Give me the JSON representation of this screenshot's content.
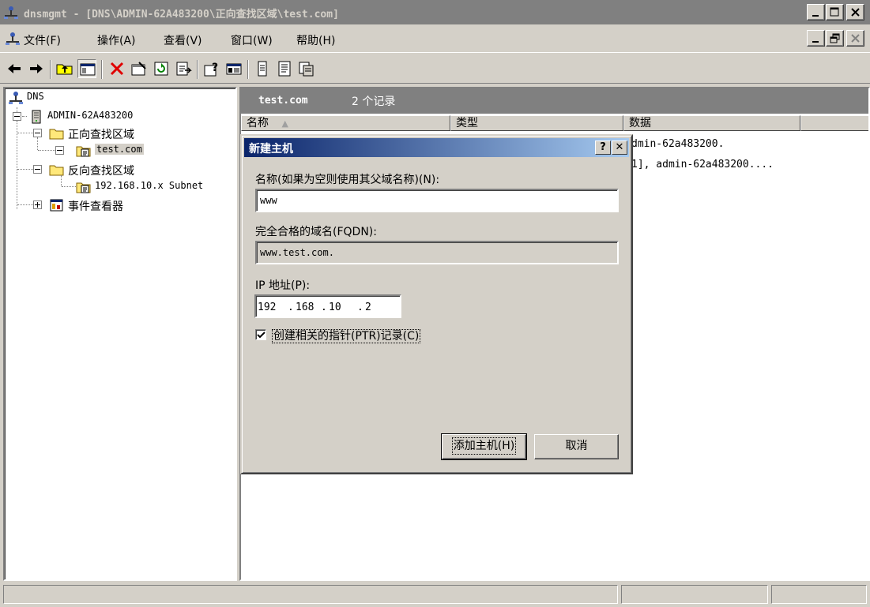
{
  "window": {
    "title": "dnsmgmt - [DNS\\ADMIN-62A483200\\正向查找区域\\test.com]"
  },
  "menubar": {
    "items": [
      "文件(F)",
      "操作(A)",
      "查看(V)",
      "窗口(W)",
      "帮助(H)"
    ]
  },
  "toolbar": {
    "buttons": [
      "back-icon",
      "forward-icon",
      "up-level-icon",
      "show-hide-tree-icon",
      "delete-icon",
      "properties-icon",
      "refresh-icon",
      "export-list-icon",
      "help-icon",
      "console-icon",
      "new-record-icon",
      "new-host-icon",
      "new-domain-icon"
    ]
  },
  "tree": {
    "root": "DNS",
    "server": "ADMIN-62A483200",
    "forward_zones": "正向查找区域",
    "forward_zone_item": "test.com",
    "reverse_zones": "反向查找区域",
    "reverse_zone_item": "192.168.10.x Subnet",
    "event_viewer": "事件查看器"
  },
  "list": {
    "zone_name": "test.com",
    "record_count": "2 个记录",
    "columns": [
      "名称",
      "类型",
      "数据"
    ],
    "rows": [
      {
        "data": "dmin-62a483200."
      },
      {
        "data": "1], admin-62a483200...."
      }
    ]
  },
  "dialog": {
    "title": "新建主机",
    "help_button": "?",
    "close_button": "✕",
    "name_label": "名称(如果为空则使用其父域名称)(N):",
    "name_value": "www",
    "fqdn_label": "完全合格的域名(FQDN):",
    "fqdn_value": "www.test.com.",
    "ip_label": "IP 地址(P):",
    "ip_octets": [
      "192",
      "168",
      "10",
      "2"
    ],
    "ptr_checkbox_label": "创建相关的指针(PTR)记录(C)",
    "ptr_checked": true,
    "add_host_button": "添加主机(H)",
    "cancel_button": "取消"
  },
  "colors": {
    "face": "#d4d0c8",
    "inactive_title": "#808080",
    "active_title_start": "#0a246a",
    "active_title_end": "#a6caf0"
  }
}
